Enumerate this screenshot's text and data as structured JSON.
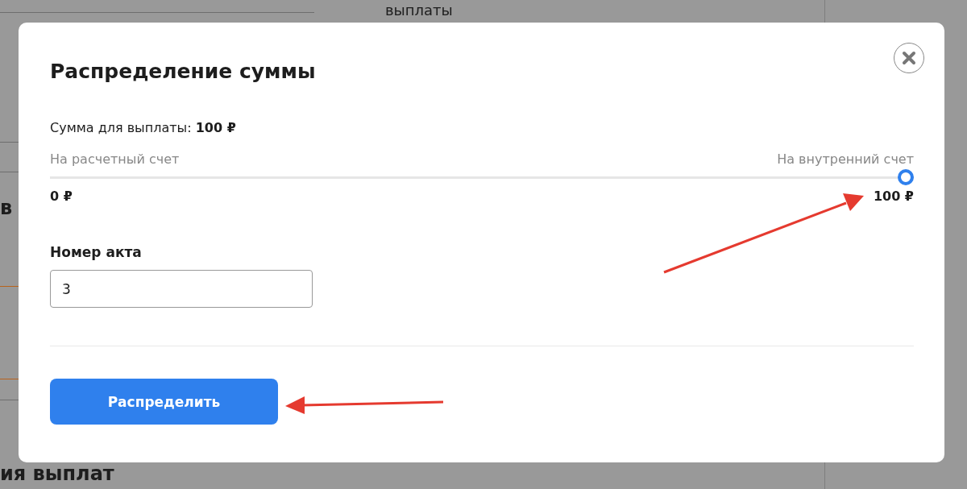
{
  "background": {
    "texts": [
      "выплаты",
      "в",
      "ия выплат"
    ]
  },
  "dialog": {
    "title": "Распределение суммы",
    "amount_text": "Сумма для выплаты: **100 ₽**",
    "slider": {
      "left_label": "На расчетный счет",
      "right_label": "На внутренний счет",
      "level": 1,
      "min_reading": "0 ₽",
      "max_reading": "100 ₽"
    },
    "act_field": {
      "label": "Номер акта",
      "value": "3"
    },
    "submit_button": "Распределить"
  }
}
